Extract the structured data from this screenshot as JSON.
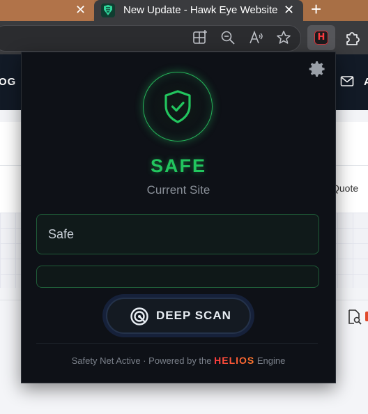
{
  "browser": {
    "tabs": [
      {
        "title": "",
        "active": false
      },
      {
        "title": "New Update - Hawk Eye Website",
        "active": true
      }
    ],
    "tab_close_glyph": "✕",
    "new_tab_glyph": "+",
    "toolbar_icons": [
      "split-screen-icon",
      "zoom-out-icon",
      "read-aloud-icon",
      "favorite-star-icon"
    ],
    "extensions": [
      {
        "name": "helios-extension-icon",
        "badge": "H",
        "active": true
      },
      {
        "name": "extensions-puzzle-icon"
      }
    ]
  },
  "page": {
    "nav_left": "OG",
    "nav_right": "A",
    "quote_link": "Quote",
    "mail_icon": "mail-icon",
    "search_doc_icon": "search-document-icon"
  },
  "popup": {
    "settings_icon": "gear-icon",
    "status_icon": "shield-check-icon",
    "status_title": "SAFE",
    "status_subtitle": "Current Site",
    "result_value": "Safe",
    "progress_percent": 0,
    "scan_button_label": "DEEP SCAN",
    "scan_icon": "target-scan-icon",
    "footer_prefix": "Safety Net Active · Powered by the",
    "footer_brand": "HELIOS",
    "footer_suffix": "Engine",
    "colors": {
      "accent_green": "#22c55e",
      "brand_red": "#ff3b3f",
      "brand_orange": "#ff7a2e",
      "popup_bg": "#0e1117"
    }
  }
}
